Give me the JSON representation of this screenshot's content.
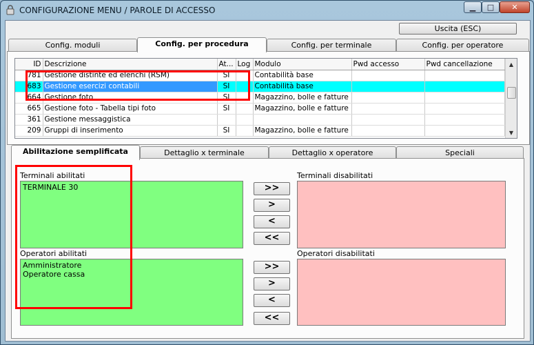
{
  "window": {
    "title": "CONFIGURAZIONE MENU / PAROLE DI ACCESSO",
    "minimize": "▁",
    "maximize": "□",
    "close": "✕"
  },
  "toolbar": {
    "exit_label": "Uscita (ESC)"
  },
  "top_tabs": [
    "Config. moduli",
    "Config. per procedura",
    "Config. per terminale",
    "Config. per operatore"
  ],
  "top_tabs_active": "Config. per procedura",
  "grid": {
    "columns": [
      "ID",
      "Descrizione",
      "At...",
      "Log",
      "Modulo",
      "Pwd accesso",
      "Pwd cancellazione"
    ],
    "rows": [
      {
        "id": "781",
        "desc": "Gestione distinte ed elenchi (RSM)",
        "at": "SI",
        "log": "",
        "modulo": "Contabilità base",
        "pwd": "",
        "pwdc": "",
        "selected": false
      },
      {
        "id": "683",
        "desc": "Gestione esercizi contabili",
        "at": "SI",
        "log": "",
        "modulo": "Contabilità base",
        "pwd": "",
        "pwdc": "",
        "selected": true
      },
      {
        "id": "664",
        "desc": "Gestione foto",
        "at": "SI",
        "log": "",
        "modulo": "Magazzino, bolle e fatture",
        "pwd": "",
        "pwdc": "",
        "selected": false
      },
      {
        "id": "665",
        "desc": "Gestione foto - Tabella tipi foto",
        "at": "SI",
        "log": "",
        "modulo": "Magazzino, bolle e fatture",
        "pwd": "",
        "pwdc": "",
        "selected": false
      },
      {
        "id": "361",
        "desc": "Gestione messaggistica",
        "at": "",
        "log": "",
        "modulo": "",
        "pwd": "",
        "pwdc": "",
        "selected": false
      },
      {
        "id": "209",
        "desc": "Gruppi di inserimento",
        "at": "SI",
        "log": "",
        "modulo": "Magazzino, bolle e fatture",
        "pwd": "",
        "pwdc": "",
        "selected": false
      }
    ]
  },
  "bottom_tabs": [
    "Abilitazione semplificata",
    "Dettaglio x terminale",
    "Dettaglio x operatore",
    "Speciali"
  ],
  "bottom_tabs_active": "Abilitazione semplificata",
  "terminali": {
    "enabled_label": "Terminali abilitati",
    "disabled_label": "Terminali disabilitati",
    "enabled": [
      "TERMINALE 30"
    ],
    "disabled": []
  },
  "operatori": {
    "enabled_label": "Operatori abilitati",
    "disabled_label": "Operatori disabilitati",
    "enabled": [
      "Amministratore",
      "Operatore cassa"
    ],
    "disabled": []
  },
  "move_buttons": {
    "all_right": ">>",
    "right": ">",
    "left": "<",
    "all_left": "<<"
  },
  "colors": {
    "enabled_list": "#80ff80",
    "disabled_list": "#ffc0c0",
    "selected_row": "#00ffff",
    "highlight": "#ff0000"
  }
}
